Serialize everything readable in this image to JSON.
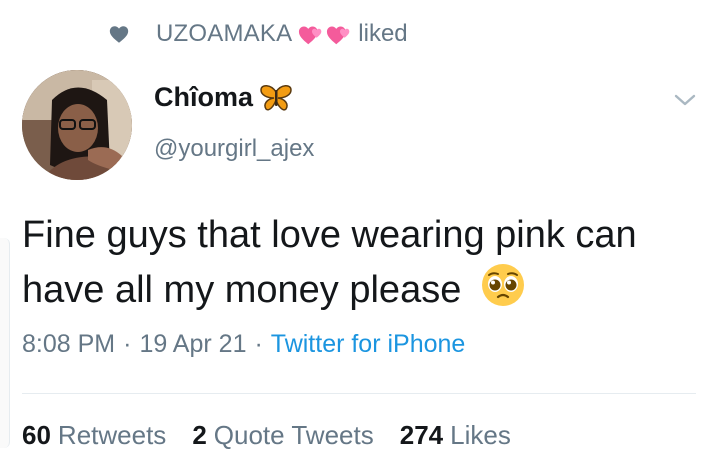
{
  "social_context": {
    "user": "UZOAMAKA",
    "action": "liked",
    "icon": "heart-icon",
    "emoji": "two-pink-hearts"
  },
  "author": {
    "display_name": "Chîoma",
    "name_emoji": "butterfly",
    "handle": "@yourgirl_ajex"
  },
  "tweet": {
    "text": "Fine guys that love wearing pink can have all my money please",
    "emoji": "pleading-face",
    "time": "8:08 PM",
    "separator": "·",
    "date": "19 Apr 21",
    "source": "Twitter for iPhone"
  },
  "stats": [
    {
      "value": "60",
      "label": "Retweets"
    },
    {
      "value": "2",
      "label": "Quote Tweets"
    },
    {
      "value": "274",
      "label": "Likes"
    }
  ],
  "colors": {
    "muted": "#657786",
    "link": "#1b95e0",
    "text": "#14171a",
    "divider": "#e6ecf0"
  }
}
